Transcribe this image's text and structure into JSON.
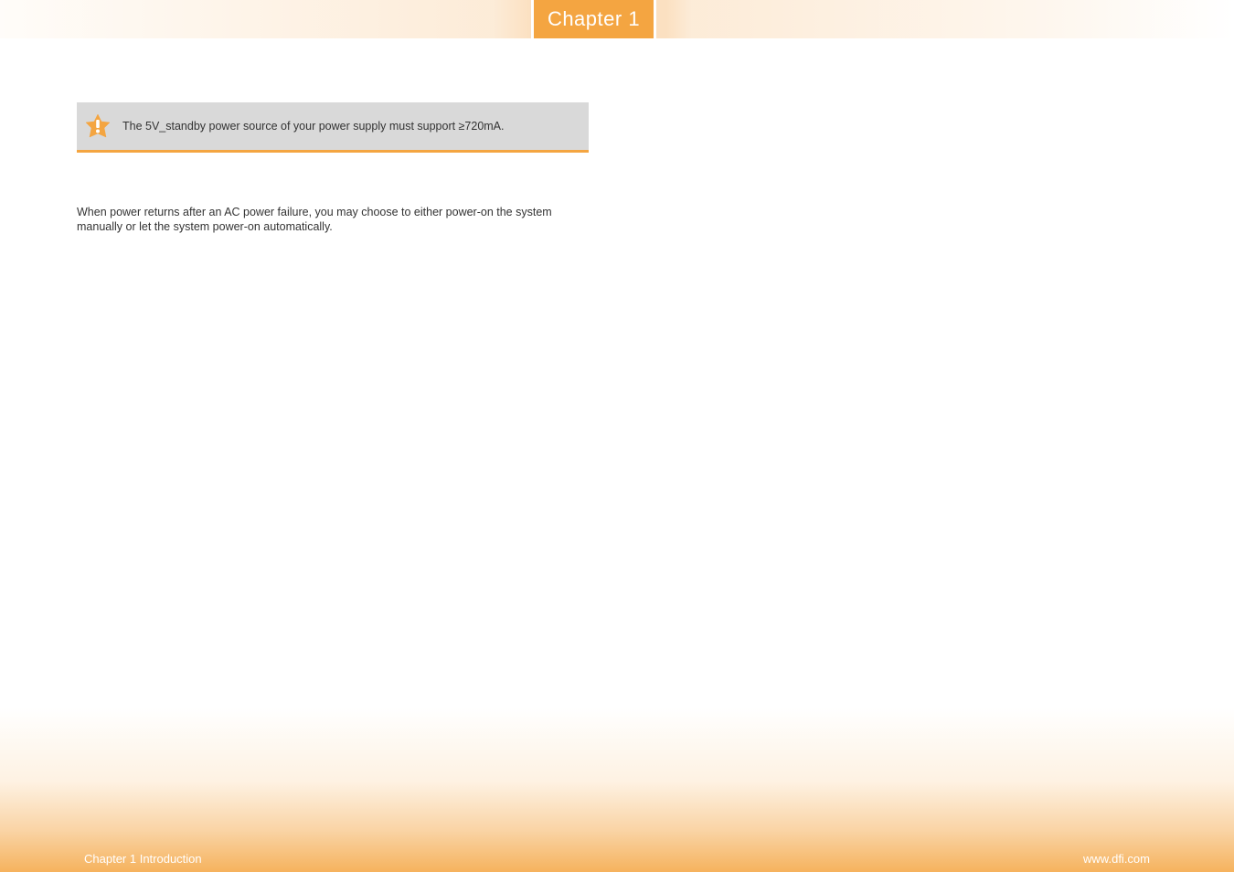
{
  "header": {
    "chapter_label": "Chapter 1"
  },
  "note": {
    "text": "The 5V_standby power source of your power supply must support ≥720mA."
  },
  "body": {
    "paragraph1": "When power returns after an AC power failure, you may choose to either power-on the system manually or let the system power-on automatically."
  },
  "footer": {
    "left": "Chapter 1 Introduction",
    "right": "www.dfi.com"
  }
}
